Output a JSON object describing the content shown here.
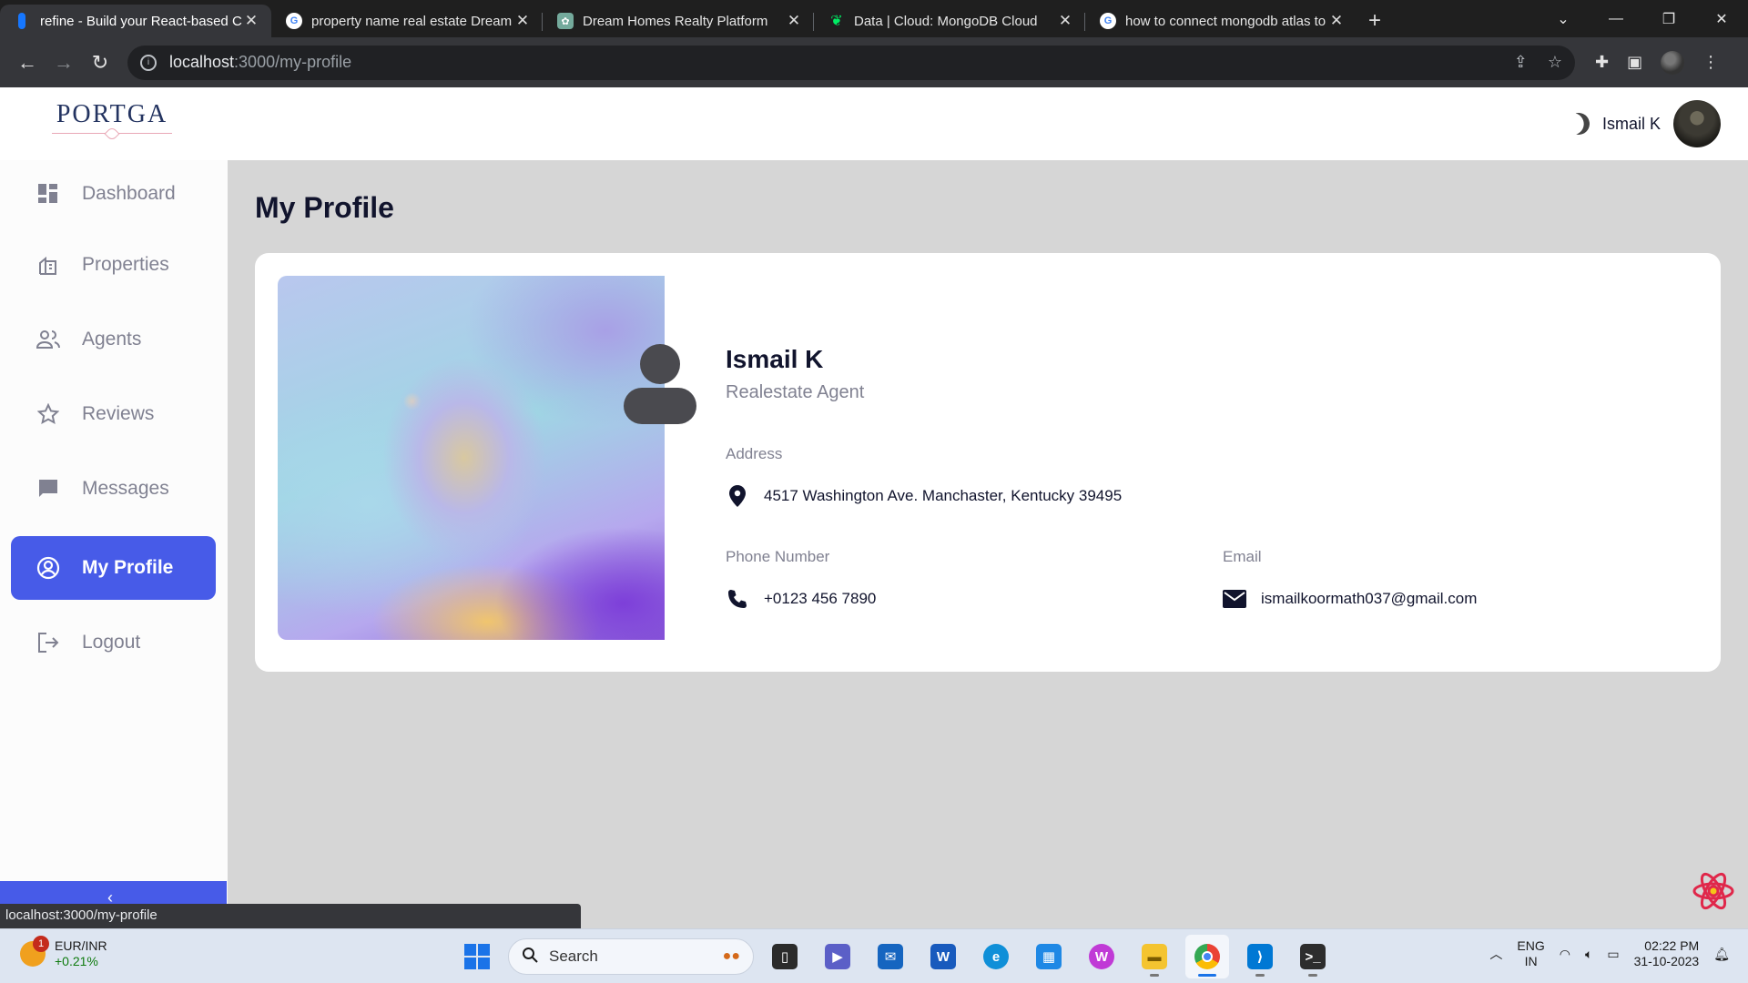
{
  "browser": {
    "tabs": [
      {
        "title": "refine - Build your React-based CRUD",
        "active": true,
        "icon": "refine-icon"
      },
      {
        "title": "property name real estate Dream Homes",
        "active": false,
        "icon": "google-icon"
      },
      {
        "title": "Dream Homes Realty Platform",
        "active": false,
        "icon": "openai-icon"
      },
      {
        "title": "Data | Cloud: MongoDB Cloud",
        "active": false,
        "icon": "mongodb-icon"
      },
      {
        "title": "how to connect mongodb atlas to",
        "active": false,
        "icon": "google-icon"
      }
    ],
    "url_host": "localhost",
    "url_path": ":3000/my-profile",
    "status_url": "localhost:3000/my-profile"
  },
  "app": {
    "logo": "PORTGA",
    "header_user": "Ismail K"
  },
  "sidebar": {
    "items": [
      {
        "label": "Dashboard",
        "icon": "dashboard-icon",
        "active": false
      },
      {
        "label": "Properties",
        "icon": "properties-icon",
        "active": false
      },
      {
        "label": "Agents",
        "icon": "agents-icon",
        "active": false
      },
      {
        "label": "Reviews",
        "icon": "star-icon",
        "active": false
      },
      {
        "label": "Messages",
        "icon": "chat-icon",
        "active": false
      },
      {
        "label": "My Profile",
        "icon": "profile-icon",
        "active": true
      },
      {
        "label": "Logout",
        "icon": "logout-icon",
        "active": false
      }
    ],
    "collapse_icon": "chevron-left-icon"
  },
  "profile": {
    "page_title": "My Profile",
    "name": "Ismail K",
    "role": "Realestate Agent",
    "address_label": "Address",
    "address": "4517 Washington Ave. Manchaster, Kentucky 39495",
    "phone_label": "Phone Number",
    "phone": "+0123 456 7890",
    "email_label": "Email",
    "email": "ismailkoormath037@gmail.com"
  },
  "taskbar": {
    "ticker_name": "EUR/INR",
    "ticker_change": "+0.21%",
    "ticker_badge": "1",
    "search_placeholder": "Search",
    "lang_top": "ENG",
    "lang_bottom": "IN",
    "time": "02:22 PM",
    "date": "31-10-2023"
  },
  "colors": {
    "accent": "#475be8",
    "text_primary": "#11142d",
    "text_secondary": "#808191",
    "main_bg": "#d6d6d6"
  }
}
